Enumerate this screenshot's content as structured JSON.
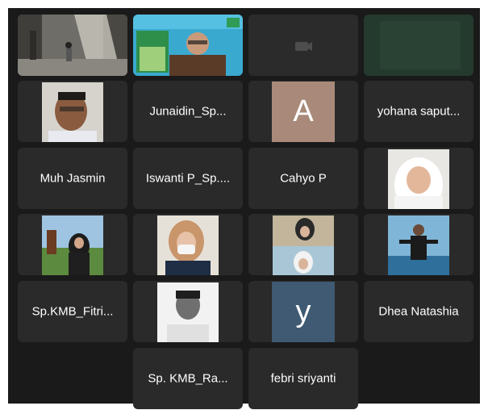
{
  "participants": [
    {
      "id": "p1",
      "kind": "video-room"
    },
    {
      "id": "p2",
      "kind": "video-banner"
    },
    {
      "id": "p3",
      "kind": "camera-off"
    },
    {
      "id": "p4",
      "kind": "blurred"
    },
    {
      "id": "p5",
      "kind": "photo"
    },
    {
      "id": "p6",
      "kind": "name",
      "name": "Junaidin_Sp..."
    },
    {
      "id": "p7",
      "kind": "letter",
      "letter": "A",
      "color": "#a98a7a"
    },
    {
      "id": "p8",
      "kind": "name",
      "name": "yohana saput..."
    },
    {
      "id": "p9",
      "kind": "name",
      "name": "Muh Jasmin"
    },
    {
      "id": "p10",
      "kind": "name",
      "name": "Iswanti P_Sp...."
    },
    {
      "id": "p11",
      "kind": "name",
      "name": "Cahyo P"
    },
    {
      "id": "p12",
      "kind": "photo"
    },
    {
      "id": "p13",
      "kind": "photo"
    },
    {
      "id": "p14",
      "kind": "photo"
    },
    {
      "id": "p15",
      "kind": "photo"
    },
    {
      "id": "p16",
      "kind": "photo"
    },
    {
      "id": "p17",
      "kind": "name",
      "name": "Sp.KMB_Fitri..."
    },
    {
      "id": "p18",
      "kind": "photo"
    },
    {
      "id": "p19",
      "kind": "letter",
      "letter": "y",
      "color": "#3f5a72"
    },
    {
      "id": "p20",
      "kind": "name",
      "name": "Dhea Natashia"
    },
    {
      "id": "p21",
      "kind": "name",
      "name": "Sp. KMB_Ra..."
    },
    {
      "id": "p22",
      "kind": "name",
      "name": "febri sriyanti"
    }
  ],
  "colors": {
    "active_speaker_border": "#3fcf5b",
    "tile_bg": "#2a2a2a",
    "grid_bg": "#1a1a1a"
  }
}
